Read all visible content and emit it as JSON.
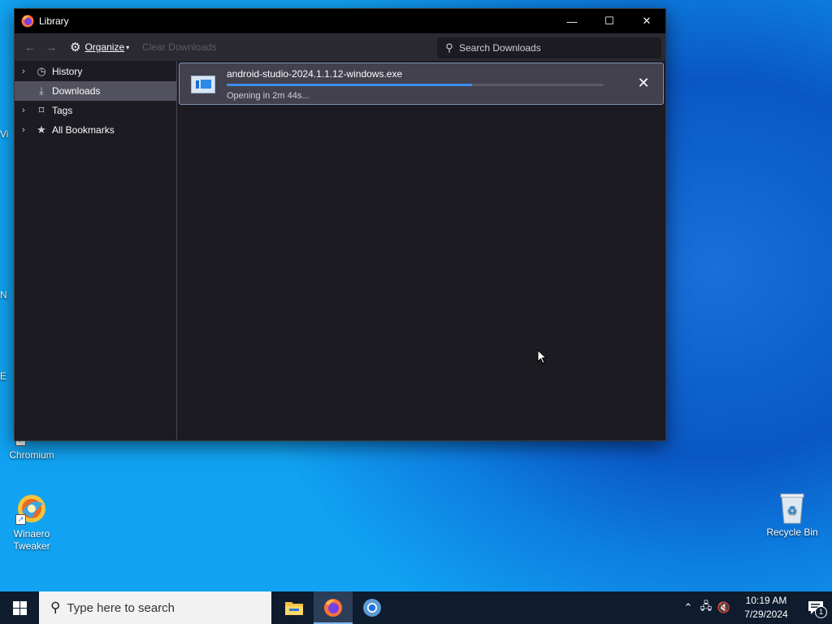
{
  "window": {
    "title": "Library",
    "minimize": "—",
    "maximize": "☐",
    "close": "✕"
  },
  "toolbar": {
    "organize_label": "Organize",
    "clear_downloads_label": "Clear Downloads",
    "search_placeholder": "Search Downloads"
  },
  "sidebar": {
    "items": [
      {
        "label": "History",
        "icon": "history-icon"
      },
      {
        "label": "Downloads",
        "icon": "download-icon",
        "selected": true
      },
      {
        "label": "Tags",
        "icon": "tag-icon"
      },
      {
        "label": "All Bookmarks",
        "icon": "star-icon"
      }
    ]
  },
  "downloads": {
    "items": [
      {
        "filename": "android-studio-2024.1.1.12-windows.exe",
        "status": "Opening in 2m 44s...",
        "progress_fraction": 0.65
      }
    ]
  },
  "desktop": {
    "icons": [
      {
        "label": "Chromium"
      },
      {
        "label": "Winaero Tweaker"
      },
      {
        "label": "Recycle Bin"
      }
    ],
    "edge_fragments": [
      "Vi",
      "N",
      "E"
    ]
  },
  "taskbar": {
    "search_placeholder": "Type here to search",
    "clock_time": "10:19 AM",
    "clock_date": "7/29/2024",
    "notification_count": "1"
  }
}
